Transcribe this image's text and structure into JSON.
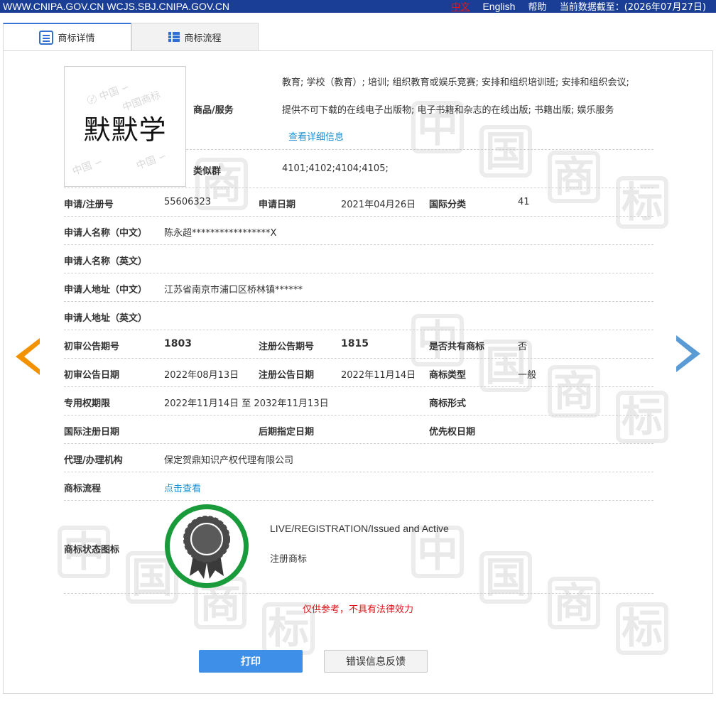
{
  "topbar": {
    "site1": "WWW.CNIPA.GOV.CN",
    "site2": "WCJS.SBJ.CNIPA.GOV.CN",
    "lang_cn": "中文",
    "lang_en": "English",
    "help": "帮助",
    "data_date": "当前数据截至：(2026年07月27日)"
  },
  "tabs": [
    {
      "label": "商标详情"
    },
    {
      "label": "商标流程"
    }
  ],
  "logo": {
    "text": "默默学"
  },
  "goods": {
    "label": "商品/服务",
    "line1": "教育; 学校（教育）; 培训; 组织教育或娱乐竞赛; 安排和组织培训班; 安排和组织会议;",
    "line2": "提供不可下载的在线电子出版物; 电子书籍和杂志的在线出版; 书籍出版; 娱乐服务",
    "more_link": "查看详细信息"
  },
  "similar_group": {
    "label": "类似群",
    "value": "4101;4102;4104;4105;"
  },
  "fields": {
    "reg_no_label": "申请/注册号",
    "reg_no": "55606323",
    "apply_date_label": "申请日期",
    "apply_date": "2021年04月26日",
    "intl_class_label": "国际分类",
    "intl_class": "41",
    "applicant_cn_label": "申请人名称（中文）",
    "applicant_cn": "陈永超*****************X",
    "applicant_en_label": "申请人名称（英文）",
    "applicant_en": "",
    "address_cn_label": "申请人地址（中文）",
    "address_cn": "江苏省南京市浦口区桥林镇******",
    "address_en_label": "申请人地址（英文）",
    "address_en": "",
    "prelim_no_label": "初审公告期号",
    "prelim_no": "1803",
    "reg_pub_no_label": "注册公告期号",
    "reg_pub_no": "1815",
    "shared_label": "是否共有商标",
    "shared": "否",
    "prelim_date_label": "初审公告日期",
    "prelim_date": "2022年08月13日",
    "reg_pub_date_label": "注册公告日期",
    "reg_pub_date": "2022年11月14日",
    "tm_type_label": "商标类型",
    "tm_type": "一般",
    "excl_period_label": "专用权期限",
    "excl_period": "2022年11月14日 至 2032年11月13日",
    "tm_form_label": "商标形式",
    "tm_form": "",
    "intl_reg_date_label": "国际注册日期",
    "intl_reg_date": "",
    "later_design_label": "后期指定日期",
    "later_design": "",
    "priority_label": "优先权日期",
    "priority": "",
    "agent_label": "代理/办理机构",
    "agent": "保定贺鼎知识产权代理有限公司",
    "flow_label": "商标流程",
    "flow_link": "点击查看"
  },
  "status": {
    "label": "商标状态图标",
    "en": "LIVE/REGISTRATION/Issued and Active",
    "cn": "注册商标"
  },
  "disclaimer": "仅供参考，不具有法律效力",
  "buttons": {
    "print": "打印",
    "feedback": "错误信息反馈"
  },
  "colors": {
    "topbar": "#1a3e95",
    "accent": "#3d8fe8",
    "status_green": "#199b3b",
    "prev_arrow": "#f39200",
    "next_arrow": "#5b9bd5"
  }
}
